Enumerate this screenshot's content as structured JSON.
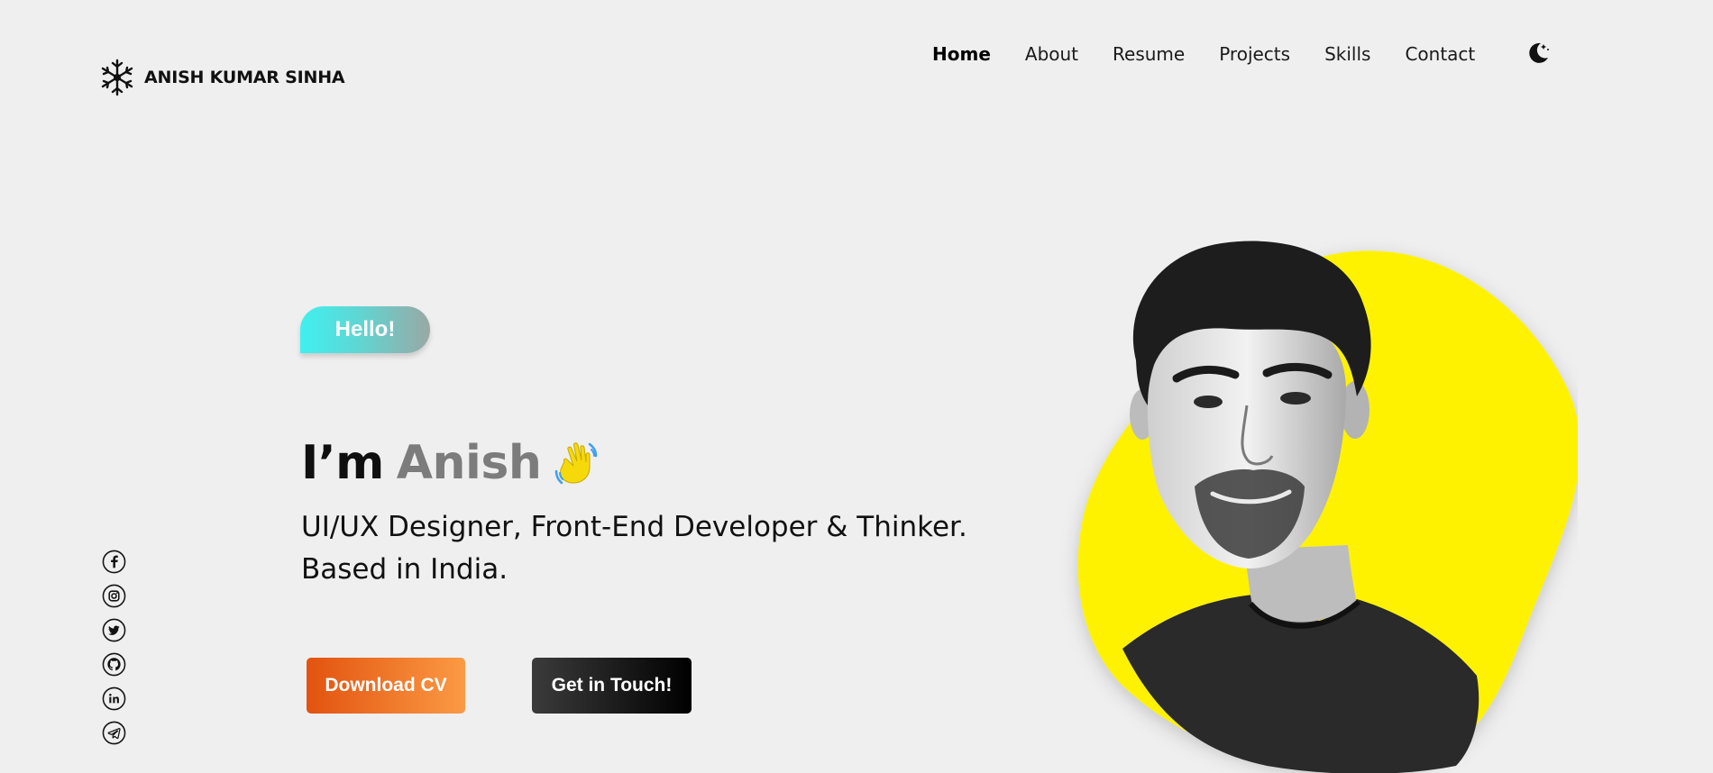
{
  "brand": {
    "name": "ANISH KUMAR SINHA",
    "logo_icon": "snowflake-icon"
  },
  "nav": {
    "items": [
      {
        "label": "Home",
        "active": true
      },
      {
        "label": "About",
        "active": false
      },
      {
        "label": "Resume",
        "active": false
      },
      {
        "label": "Projects",
        "active": false
      },
      {
        "label": "Skills",
        "active": false
      },
      {
        "label": "Contact",
        "active": false
      }
    ],
    "theme_toggle_icon": "moon-icon"
  },
  "hero": {
    "badge": "Hello!",
    "heading_prefix": "I’m",
    "heading_name": "Anish",
    "wave_icon": "waving-hand-icon",
    "tagline_line1": "UI/UX Designer, Front-End Developer & Thinker.",
    "tagline_line2": "Based in India.",
    "download_label": "Download CV",
    "contact_label": "Get in Touch!"
  },
  "social": [
    {
      "name": "facebook-icon"
    },
    {
      "name": "instagram-icon"
    },
    {
      "name": "twitter-icon"
    },
    {
      "name": "github-icon"
    },
    {
      "name": "linkedin-icon"
    },
    {
      "name": "telegram-icon"
    }
  ],
  "colors": {
    "background": "#efefef",
    "blob": "#fff200",
    "hello_gradient_start": "#3ff0ef",
    "download_gradient": [
      "#e2530f",
      "#fb9a45"
    ],
    "contact_gradient": [
      "#3b3b3b",
      "#000000"
    ],
    "name_accent": "#7c7c7c"
  }
}
